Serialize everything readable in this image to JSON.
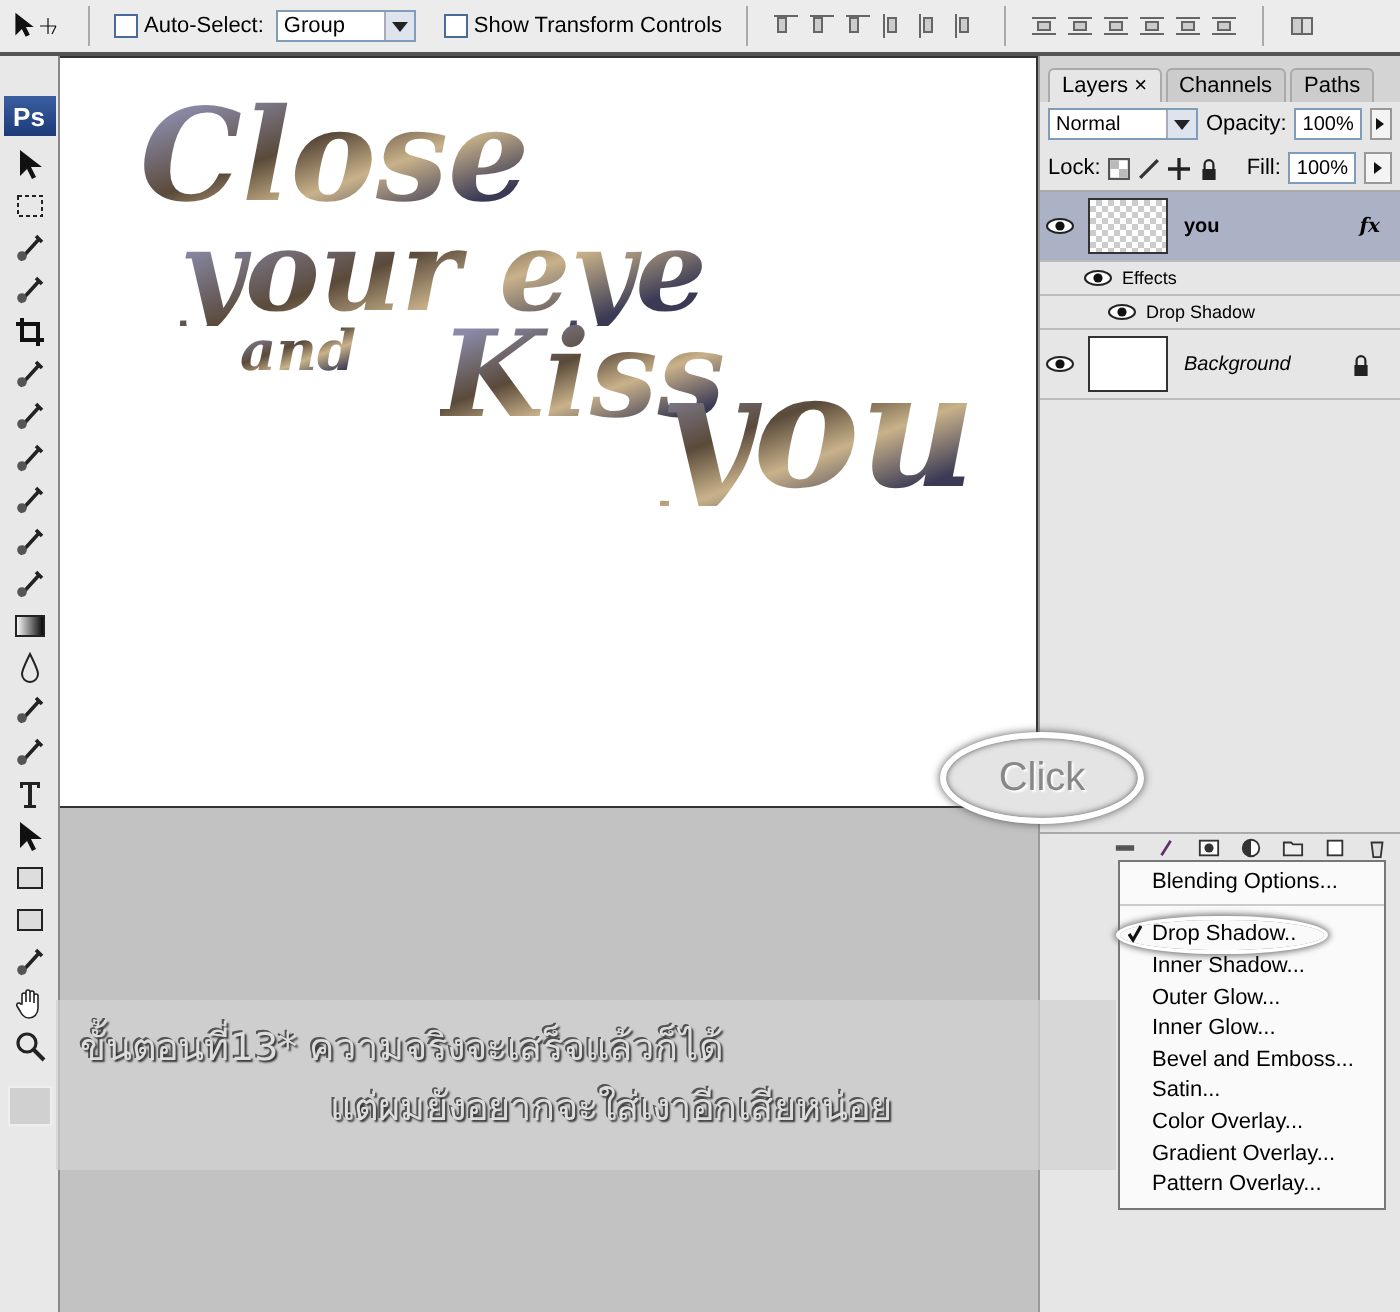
{
  "options_bar": {
    "auto_select": {
      "label": "Auto-Select:",
      "checked": false
    },
    "auto_select_target": "Group",
    "transform_controls": {
      "label": "Show Transform Controls",
      "checked": false
    }
  },
  "toolbox": {
    "logo": "Ps"
  },
  "canvas": {
    "artwork_lines": [
      "Close",
      "your eye",
      "and",
      "Kiss",
      "you"
    ]
  },
  "layers_panel": {
    "tabs": [
      {
        "label": "Layers",
        "selected": true,
        "close": "×"
      },
      {
        "label": "Channels",
        "selected": false
      },
      {
        "label": "Paths",
        "selected": false
      }
    ],
    "blend_mode": "Normal",
    "opacity_label": "Opacity:",
    "opacity": "100%",
    "lock_label": "Lock:",
    "fill_label": "Fill:",
    "fill": "100%",
    "layers": [
      {
        "name": "you",
        "selected": true,
        "visible": true,
        "locked": false,
        "fx": "fx",
        "children": [
          {
            "name": "Effects",
            "visible": true,
            "children": [
              {
                "name": "Drop Shadow",
                "visible": true
              }
            ]
          }
        ]
      },
      {
        "name": "Background",
        "selected": false,
        "visible": true,
        "locked": true
      }
    ]
  },
  "style_menu": {
    "items": [
      {
        "label": "Blending Options...",
        "checked": false
      },
      {
        "label": "Drop Shadow..",
        "checked": true
      },
      {
        "label": "Inner Shadow...",
        "checked": false
      },
      {
        "label": "Outer Glow...",
        "checked": false
      },
      {
        "label": "Inner Glow...",
        "checked": false
      },
      {
        "label": "Bevel and Emboss...",
        "checked": false
      },
      {
        "label": "Satin...",
        "checked": false
      },
      {
        "label": "Color Overlay...",
        "checked": false
      },
      {
        "label": "Gradient Overlay...",
        "checked": false
      },
      {
        "label": "Pattern Overlay...",
        "checked": false
      }
    ]
  },
  "callout": {
    "text": "Click"
  },
  "caption": {
    "lines": [
      "ขั้นตอนที่13*  ความจริงจะเสร็จแล้วก็ได้",
      "แต่ผมยังอยากจะใส่เงาอีกเสียหน่อย"
    ]
  }
}
